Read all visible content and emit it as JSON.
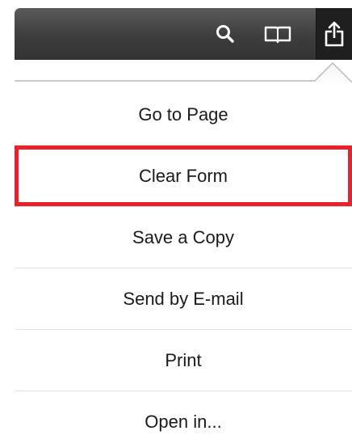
{
  "toolbar": {
    "icons": [
      "search-icon",
      "book-icon",
      "share-icon"
    ],
    "active": "share-icon"
  },
  "menu": {
    "items": [
      {
        "label": "Go to Page",
        "highlighted": false
      },
      {
        "label": "Clear Form",
        "highlighted": true
      },
      {
        "label": "Save a Copy",
        "highlighted": false
      },
      {
        "label": "Send by E-mail",
        "highlighted": false
      },
      {
        "label": "Print",
        "highlighted": false
      },
      {
        "label": "Open in...",
        "highlighted": false
      }
    ]
  },
  "colors": {
    "toolbar": "#3d3d3d",
    "highlight_border": "#e8212b",
    "separator": "#e3e3e3",
    "text": "#1a1a1a"
  }
}
